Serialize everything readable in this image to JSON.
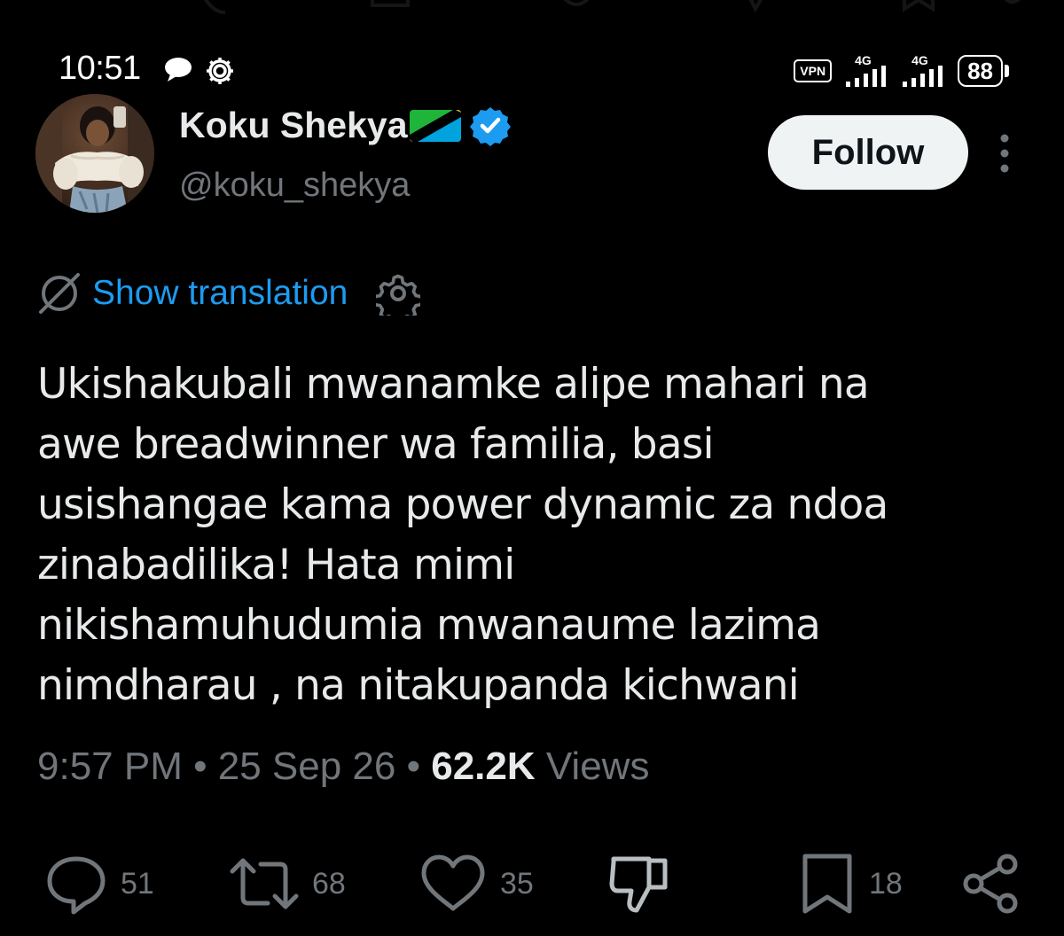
{
  "status_bar": {
    "time": "10:51",
    "vpn": "VPN",
    "network_1": "4G",
    "network_2": "4G",
    "battery": "88",
    "icons": [
      "chat-bubble-icon",
      "settings-gear-icon",
      "signal-icon",
      "battery-icon"
    ]
  },
  "profile": {
    "display_name": "Koku Shekya",
    "flag": "tanzania-flag-icon",
    "verified": "verified-badge-icon",
    "handle": "@koku_shekya",
    "follow_label": "Follow"
  },
  "translation": {
    "link_label": "Show translation"
  },
  "tweet": {
    "text": "Ukishakubali mwanamke alipe mahari na\nawe breadwinner wa familia, basi\nusishangae kama power dynamic za ndoa\nzinabadilika! Hata mimi\nnikishamuhudumia mwanaume lazima\nnimdharau , na nitakupanda kichwani"
  },
  "meta": {
    "time": "9:57 PM",
    "separator": " • ",
    "date": "25 Sep 26",
    "views_count": "62.2K",
    "views_label": "Views"
  },
  "actions": {
    "replies": "51",
    "reposts": "68",
    "likes": "35",
    "bookmarks": "18"
  },
  "colors": {
    "background": "#000000",
    "text_primary": "#e7e9ea",
    "text_secondary": "#71767b",
    "accent": "#1d9bf0",
    "follow_bg": "#eff3f4"
  }
}
